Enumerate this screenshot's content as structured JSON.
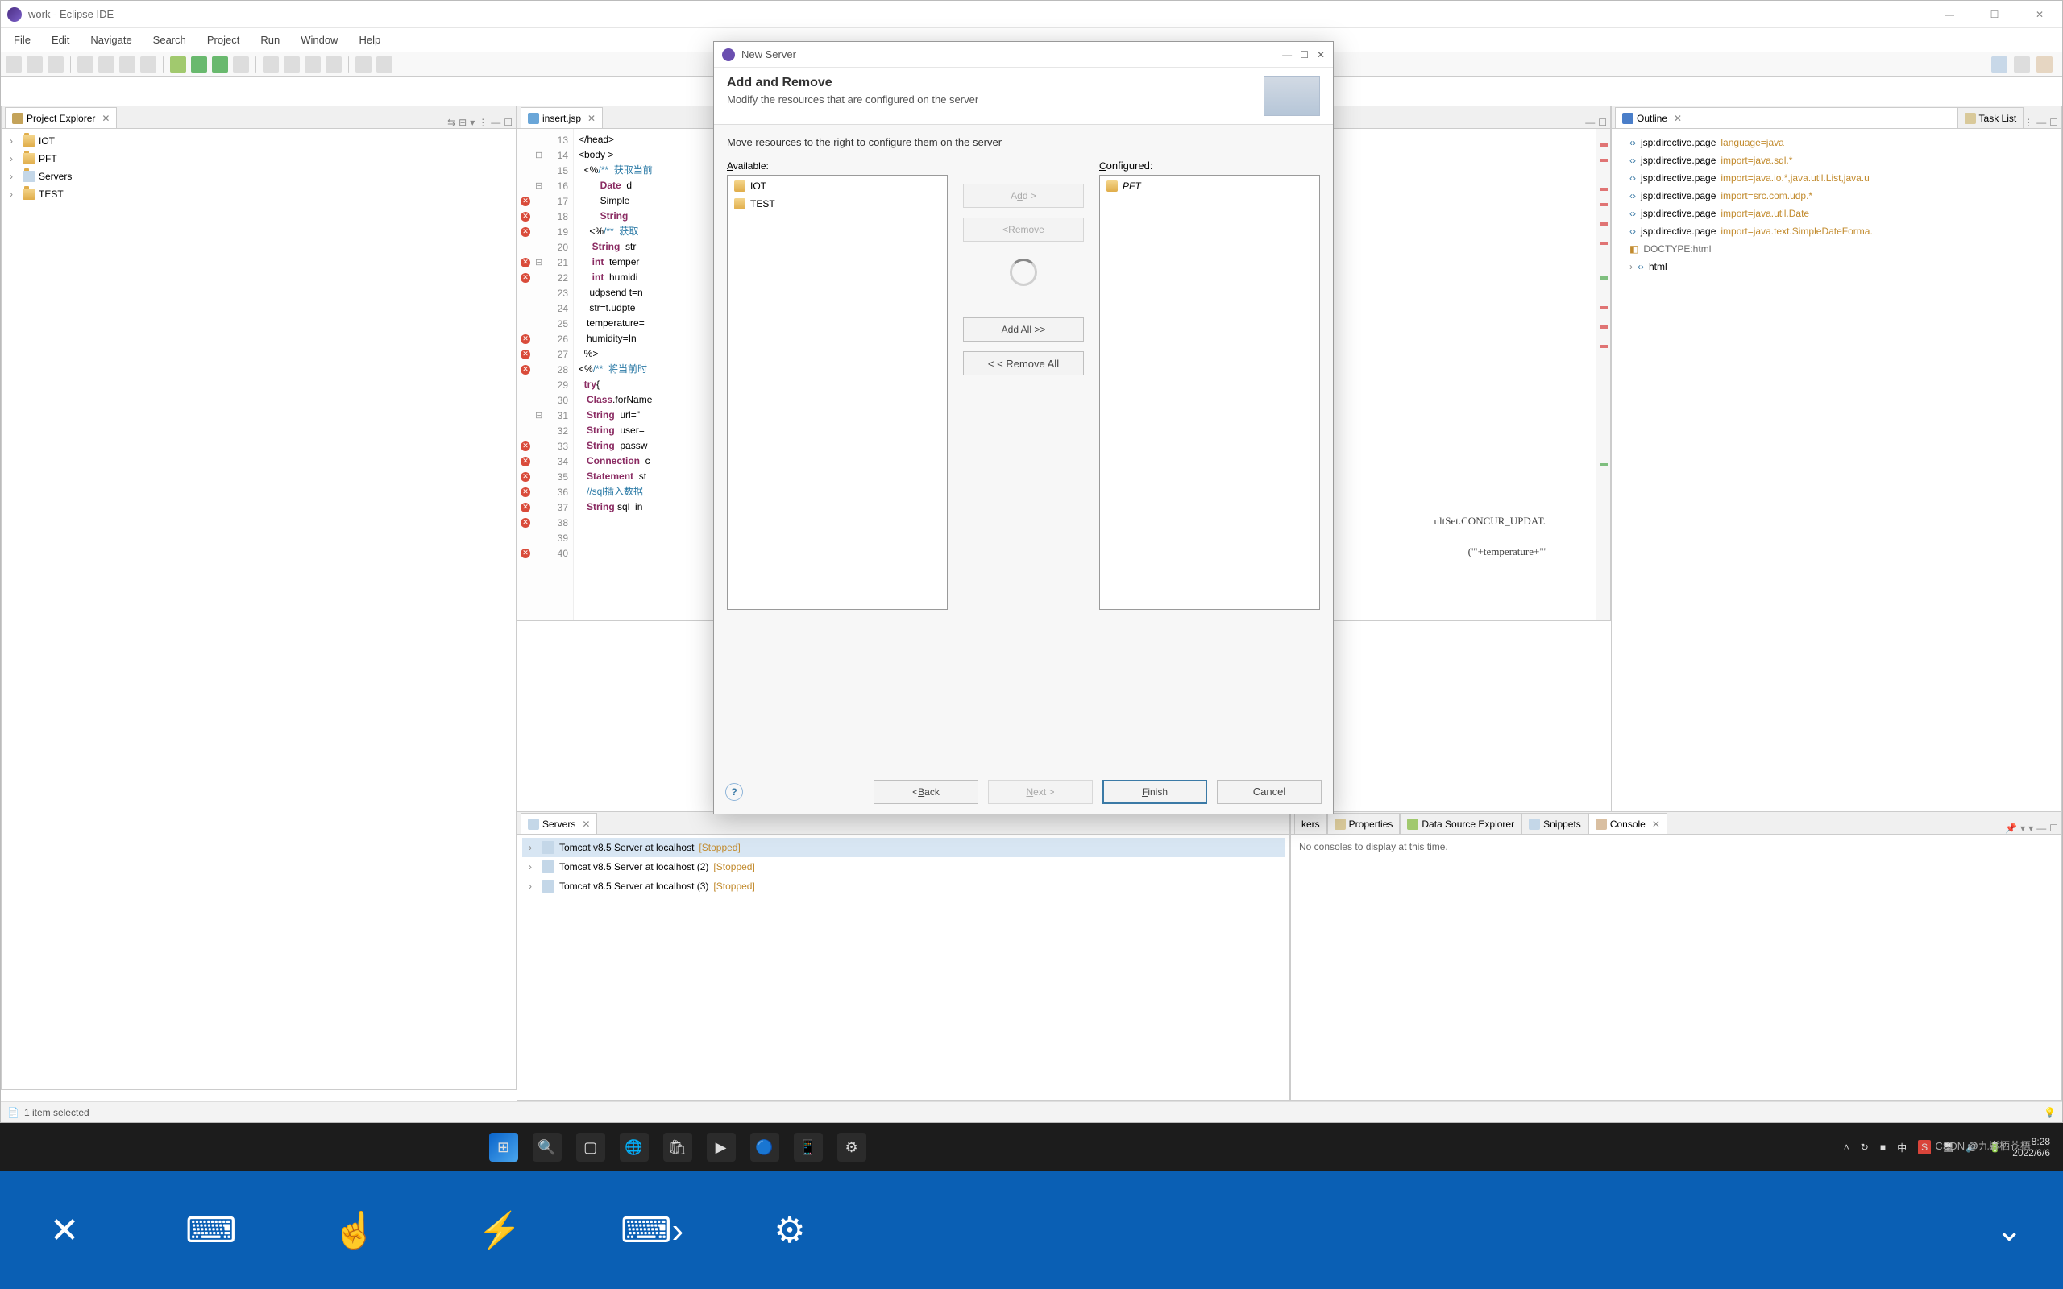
{
  "window": {
    "title": "work - Eclipse IDE"
  },
  "menu": [
    "File",
    "Edit",
    "Navigate",
    "Search",
    "Project",
    "Run",
    "Window",
    "Help"
  ],
  "projectExplorer": {
    "title": "Project Explorer",
    "items": [
      "IOT",
      "PFT",
      "Servers",
      "TEST"
    ]
  },
  "editor": {
    "tab": "insert.jsp",
    "lines": [
      {
        "n": 13,
        "t": "</head>",
        "err": false,
        "fold": false
      },
      {
        "n": 14,
        "t": "<body >",
        "err": false,
        "fold": true
      },
      {
        "n": 15,
        "t": "",
        "err": false,
        "fold": false
      },
      {
        "n": 16,
        "t": "  <%/**  获取当前",
        "err": false,
        "fold": true
      },
      {
        "n": 17,
        "t": "        Date  d",
        "err": true,
        "fold": false
      },
      {
        "n": 18,
        "t": "        Simple",
        "err": true,
        "fold": false
      },
      {
        "n": 19,
        "t": "        String",
        "err": true,
        "fold": false
      },
      {
        "n": 20,
        "t": "",
        "err": false,
        "fold": false
      },
      {
        "n": 21,
        "t": "    <%/**  获取",
        "err": true,
        "fold": true
      },
      {
        "n": 22,
        "t": "     String  str",
        "err": true,
        "fold": false
      },
      {
        "n": 23,
        "t": "     int  temper",
        "err": false,
        "fold": false
      },
      {
        "n": 24,
        "t": "     int  humidi",
        "err": false,
        "fold": false
      },
      {
        "n": 25,
        "t": "    udpsend t=n",
        "err": false,
        "fold": false
      },
      {
        "n": 26,
        "t": "    str=t.udpte",
        "err": true,
        "fold": false
      },
      {
        "n": 27,
        "t": "   temperature=",
        "err": true,
        "fold": false
      },
      {
        "n": 28,
        "t": "   humidity=In",
        "err": true,
        "fold": false
      },
      {
        "n": 29,
        "t": "  %>",
        "err": false,
        "fold": false
      },
      {
        "n": 30,
        "t": "",
        "err": false,
        "fold": false
      },
      {
        "n": 31,
        "t": "<%/**  将当前时",
        "err": false,
        "fold": true
      },
      {
        "n": 32,
        "t": "  try{",
        "err": false,
        "fold": false
      },
      {
        "n": 33,
        "t": "   Class.forName",
        "err": true,
        "fold": false
      },
      {
        "n": 34,
        "t": "   String  url=\"",
        "err": true,
        "fold": false
      },
      {
        "n": 35,
        "t": "   String  user=",
        "err": true,
        "fold": false
      },
      {
        "n": 36,
        "t": "   String  passw",
        "err": true,
        "fold": false
      },
      {
        "n": 37,
        "t": "   Connection  c",
        "err": true,
        "fold": false
      },
      {
        "n": 38,
        "t": "   Statement  st",
        "err": true,
        "fold": false
      },
      {
        "n": 39,
        "t": "   //sql插入数据",
        "err": false,
        "fold": false
      },
      {
        "n": 40,
        "t": "   String sql  in",
        "err": true,
        "fold": false
      }
    ],
    "tailA": "ultSet.CONCUR_UPDAT.",
    "tailB": "('\"+temperature+\"'"
  },
  "outline": {
    "title": "Outline",
    "taskTitle": "Task List",
    "items": [
      {
        "dir": "jsp:directive.page",
        "attr": "language=java"
      },
      {
        "dir": "jsp:directive.page",
        "attr": "import=java.sql.*"
      },
      {
        "dir": "jsp:directive.page",
        "attr": "import=java.io.*,java.util.List,java.u"
      },
      {
        "dir": "jsp:directive.page",
        "attr": "import=src.com.udp.*"
      },
      {
        "dir": "jsp:directive.page",
        "attr": "import=java.util.Date"
      },
      {
        "dir": "jsp:directive.page",
        "attr": "import=java.text.SimpleDateForma."
      }
    ],
    "doctype": "DOCTYPE:html",
    "html": "html"
  },
  "servers": {
    "title": "Servers",
    "items": [
      {
        "name": "Tomcat v8.5 Server at localhost",
        "state": "[Stopped]",
        "sel": true
      },
      {
        "name": "Tomcat v8.5 Server at localhost (2)",
        "state": "[Stopped]",
        "sel": false
      },
      {
        "name": "Tomcat v8.5 Server at localhost (3)",
        "state": "[Stopped]",
        "sel": false
      }
    ]
  },
  "consoleTabs": [
    "kers",
    "Properties",
    "Data Source Explorer",
    "Snippets",
    "Console"
  ],
  "console": {
    "empty": "No consoles to display at this time."
  },
  "status": {
    "msg": "1 item selected"
  },
  "dialog": {
    "title": "New Server",
    "heading": "Add and Remove",
    "sub": "Modify the resources that are configured on the server",
    "hint": "Move resources to the right to configure them on the server",
    "availLabel": "Available:",
    "cfgLabel": "Configured:",
    "available": [
      "IOT",
      "TEST"
    ],
    "configured": [
      "PFT"
    ],
    "btn": {
      "add": "Add >",
      "remove": "< Remove",
      "addAll": "Add All >>",
      "removeAll": "< < Remove All",
      "back": "< Back",
      "next": "Next >",
      "finish": "Finish",
      "cancel": "Cancel"
    }
  },
  "tray": {
    "time": "8:28",
    "date": "2022/6/6"
  },
  "watermark": "CSDN @九嶷栖苍梧"
}
